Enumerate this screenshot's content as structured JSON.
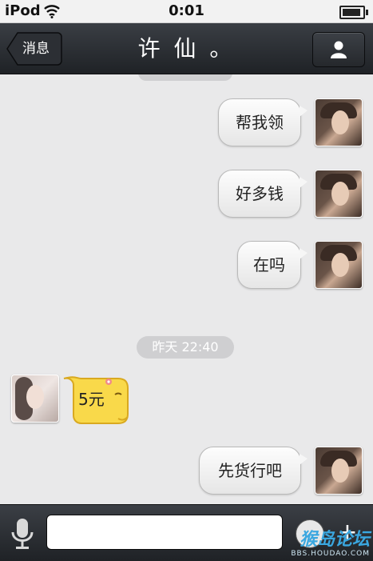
{
  "status_bar": {
    "carrier": "iPod",
    "time": "0:01",
    "battery_level": 0.9
  },
  "nav": {
    "back_label": "消息",
    "title": "许  仙 。"
  },
  "messages": [
    {
      "sender": "me",
      "text": "帮我领"
    },
    {
      "sender": "me",
      "text": "好多钱"
    },
    {
      "sender": "me",
      "text": "在吗"
    },
    {
      "sender": "system",
      "text": "昨天 22:40"
    },
    {
      "sender": "other",
      "text": "5元"
    },
    {
      "sender": "me",
      "text": "先货行吧"
    }
  ],
  "input": {
    "value": "",
    "placeholder": ""
  },
  "watermark": {
    "main": "猴岛论坛",
    "sub": "BBS.HOUDAO.COM"
  },
  "icons": {
    "back": "chevron-left-icon",
    "profile": "person-icon",
    "mic": "microphone-icon",
    "emoji": "smiley-icon",
    "plus": "plus-icon"
  },
  "colors": {
    "nav_bg": "#2a2d32",
    "chat_bg": "#e9e9ea",
    "timestamp_bg": "#cfcfd1",
    "money_bubble": "#f9d94a"
  }
}
